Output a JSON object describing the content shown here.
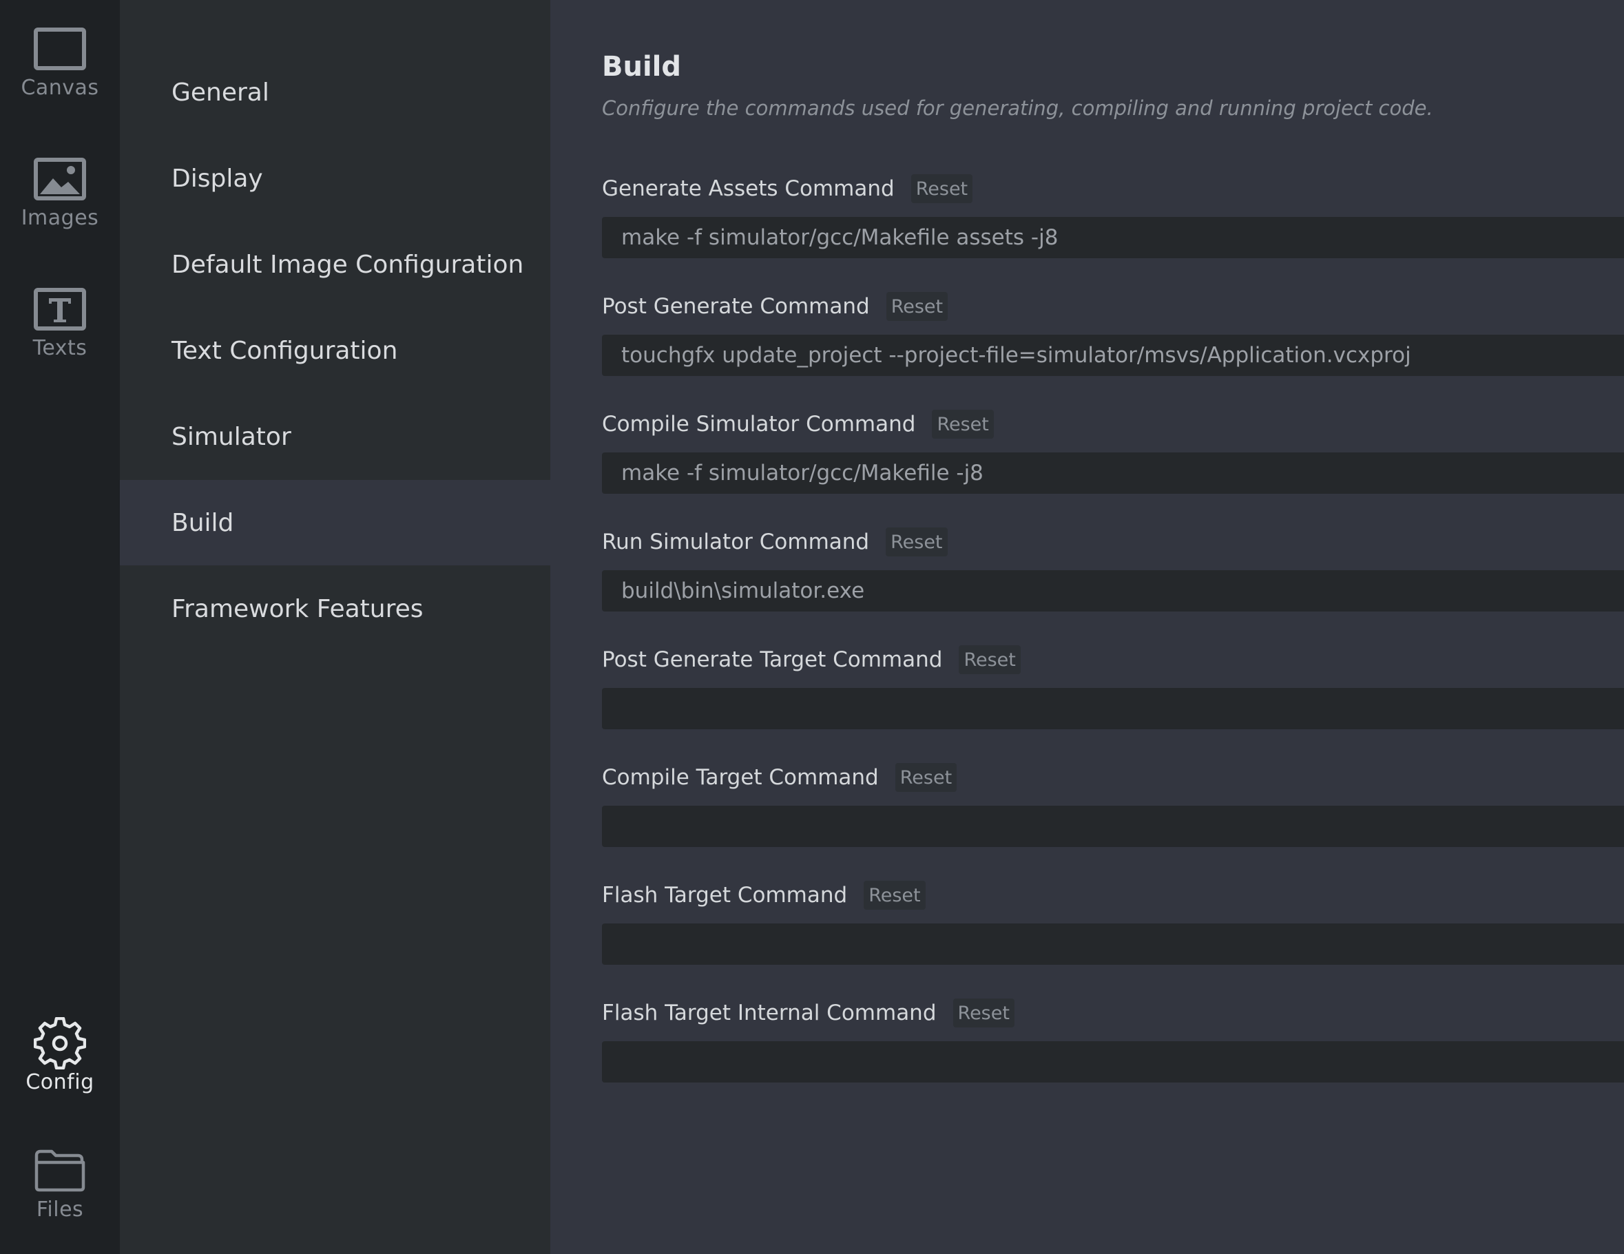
{
  "rail": {
    "items": [
      {
        "label": "Canvas",
        "icon": "canvas-icon"
      },
      {
        "label": "Images",
        "icon": "image-icon"
      },
      {
        "label": "Texts",
        "icon": "text-icon"
      },
      {
        "label": "Config",
        "icon": "gear-icon",
        "active": true
      },
      {
        "label": "Files",
        "icon": "folder-icon"
      }
    ]
  },
  "menu": {
    "items": [
      {
        "label": "General"
      },
      {
        "label": "Display"
      },
      {
        "label": "Default Image Configuration"
      },
      {
        "label": "Text Configuration"
      },
      {
        "label": "Simulator"
      },
      {
        "label": "Build",
        "active": true
      },
      {
        "label": "Framework Features"
      }
    ]
  },
  "content": {
    "title": "Build",
    "subtitle": "Configure the commands used for generating, compiling and running project code.",
    "reset_label": "Reset",
    "fields": [
      {
        "label": "Generate Assets Command",
        "value": "make -f simulator/gcc/Makefile assets -j8"
      },
      {
        "label": "Post Generate Command",
        "value": "touchgfx update_project --project-file=simulator/msvs/Application.vcxproj"
      },
      {
        "label": "Compile Simulator Command",
        "value": "make -f simulator/gcc/Makefile -j8"
      },
      {
        "label": "Run Simulator Command",
        "value": "build\\bin\\simulator.exe"
      },
      {
        "label": "Post Generate Target Command",
        "value": ""
      },
      {
        "label": "Compile Target Command",
        "value": ""
      },
      {
        "label": "Flash Target Command",
        "value": ""
      },
      {
        "label": "Flash Target Internal Command",
        "value": ""
      }
    ]
  },
  "colors": {
    "rail_bg": "#1e2124",
    "menu_bg": "#292d30",
    "content_bg": "#333640",
    "input_bg": "#25282b",
    "icon_stroke": "#868b92",
    "icon_active": "#e6e8ea"
  }
}
